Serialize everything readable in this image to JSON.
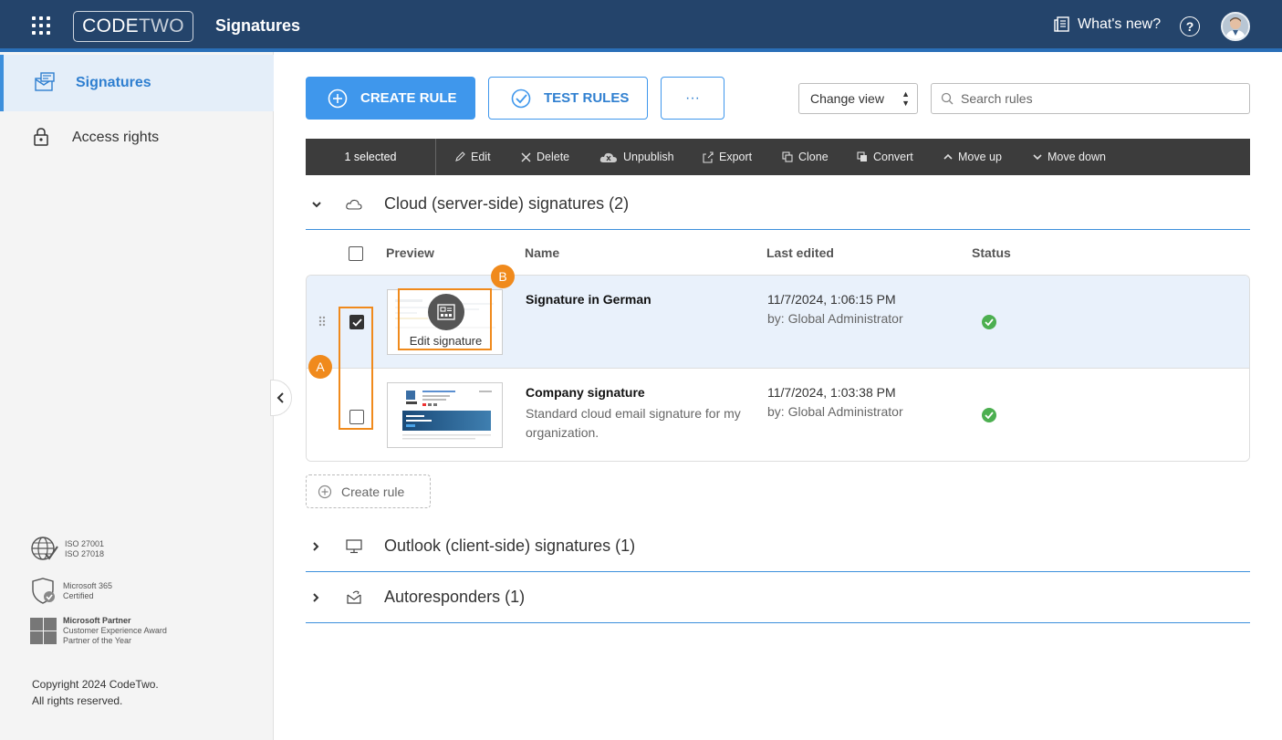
{
  "header": {
    "logo_code": "CODE",
    "logo_two": "TWO",
    "app_title": "Signatures",
    "whats_new": "What's new?",
    "help": "?"
  },
  "sidebar": {
    "items": [
      {
        "label": "Signatures",
        "icon": "signatures-icon",
        "active": true
      },
      {
        "label": "Access rights",
        "icon": "lock-icon",
        "active": false
      }
    ],
    "badges": [
      {
        "lines": [
          "ISO 27001",
          "ISO 27018"
        ],
        "icon": "globe-check-icon"
      },
      {
        "lines": [
          "Microsoft 365",
          "Certified"
        ],
        "icon": "shield-check-icon"
      },
      {
        "lines": [
          "Microsoft Partner",
          "Customer Experience Award",
          "Partner of the Year"
        ],
        "icon": "microsoft-logo-icon"
      }
    ],
    "copyright": [
      "Copyright 2024 CodeTwo.",
      "All rights reserved."
    ]
  },
  "toolbar": {
    "create_rule": "CREATE RULE",
    "test_rules": "TEST RULES",
    "more": "···",
    "change_view": "Change view",
    "search_placeholder": "Search rules"
  },
  "actionbar": {
    "selected": "1 selected",
    "actions": [
      "Edit",
      "Delete",
      "Unpublish",
      "Export",
      "Clone",
      "Convert",
      "Move up",
      "Move down"
    ]
  },
  "sections": {
    "cloud": "Cloud (server-side) signatures (2)",
    "outlook": "Outlook (client-side) signatures (1)",
    "autoresponders": "Autoresponders (1)"
  },
  "table": {
    "columns": {
      "preview": "Preview",
      "name": "Name",
      "last_edited": "Last edited",
      "status": "Status"
    },
    "rows": [
      {
        "name": "Signature in German",
        "description": "",
        "date": "11/7/2024, 1:06:15 PM",
        "by": "by: Global Administrator",
        "selected": true,
        "status": "published"
      },
      {
        "name": "Company signature",
        "description": "Standard cloud email signature for my organization.",
        "date": "11/7/2024, 1:03:38 PM",
        "by": "by: Global Administrator",
        "selected": false,
        "status": "published"
      }
    ],
    "edit_signature": "Edit signature"
  },
  "create_rule_inline": "Create rule",
  "annotations": {
    "a": "A",
    "b": "B"
  },
  "colors": {
    "header": "#24446b",
    "accent": "#3f97ec",
    "annotation": "#f08a1c",
    "status_ok": "#4caf50"
  }
}
